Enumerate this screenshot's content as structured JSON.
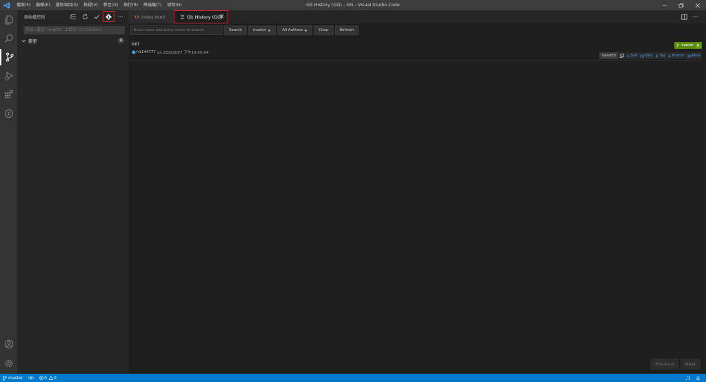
{
  "titlebar": {
    "menus": [
      "檔案(F)",
      "編輯(E)",
      "選取項目(S)",
      "檢視(V)",
      "移至(G)",
      "執行(R)",
      "終端機(T)",
      "說明(H)"
    ],
    "window_title": "Git History (GG) - GG - Visual Studio Code"
  },
  "activitybar": {
    "icons": [
      "explorer-icon",
      "search-icon",
      "source-control-icon",
      "run-debug-icon",
      "extensions-icon",
      "git-graph-icon",
      "account-icon",
      "settings-gear-icon"
    ]
  },
  "sidebar": {
    "title": "原始檔控制",
    "commit_placeholder": "訊息 (要在 'master' 上認可 Ctrl+Enter)",
    "changes_label": "變更",
    "changes_count": "0"
  },
  "tabs": [
    {
      "label": "index.html",
      "icon": "html-file-icon",
      "active": false
    },
    {
      "label": "Git History (GG)",
      "icon": "git-history-icon",
      "active": true
    }
  ],
  "toolbar": {
    "search_placeholder": "Enter term and press enter to search",
    "search_label": "Search",
    "branch_label": "master",
    "authors_label": "All Authors",
    "clear_label": "Clear",
    "refresh_label": "Refresh"
  },
  "commit": {
    "message": "init",
    "author": "h1144777",
    "date_text": "on 2020/10/7 下午10:45:04",
    "branch": "master",
    "hash": "7a0e655",
    "actions": [
      "Soft",
      "Hard",
      "Tag",
      "Branch",
      "More"
    ]
  },
  "pager": {
    "previous_label": "Previous",
    "next_label": "Next"
  },
  "statusbar": {
    "branch": "master",
    "errors": "0",
    "warnings": "0"
  },
  "colors": {
    "statusbar": "#007acc",
    "highlight": "#e0202a",
    "branch_badge": "#5a8a0c",
    "link": "#4a9fe0"
  }
}
